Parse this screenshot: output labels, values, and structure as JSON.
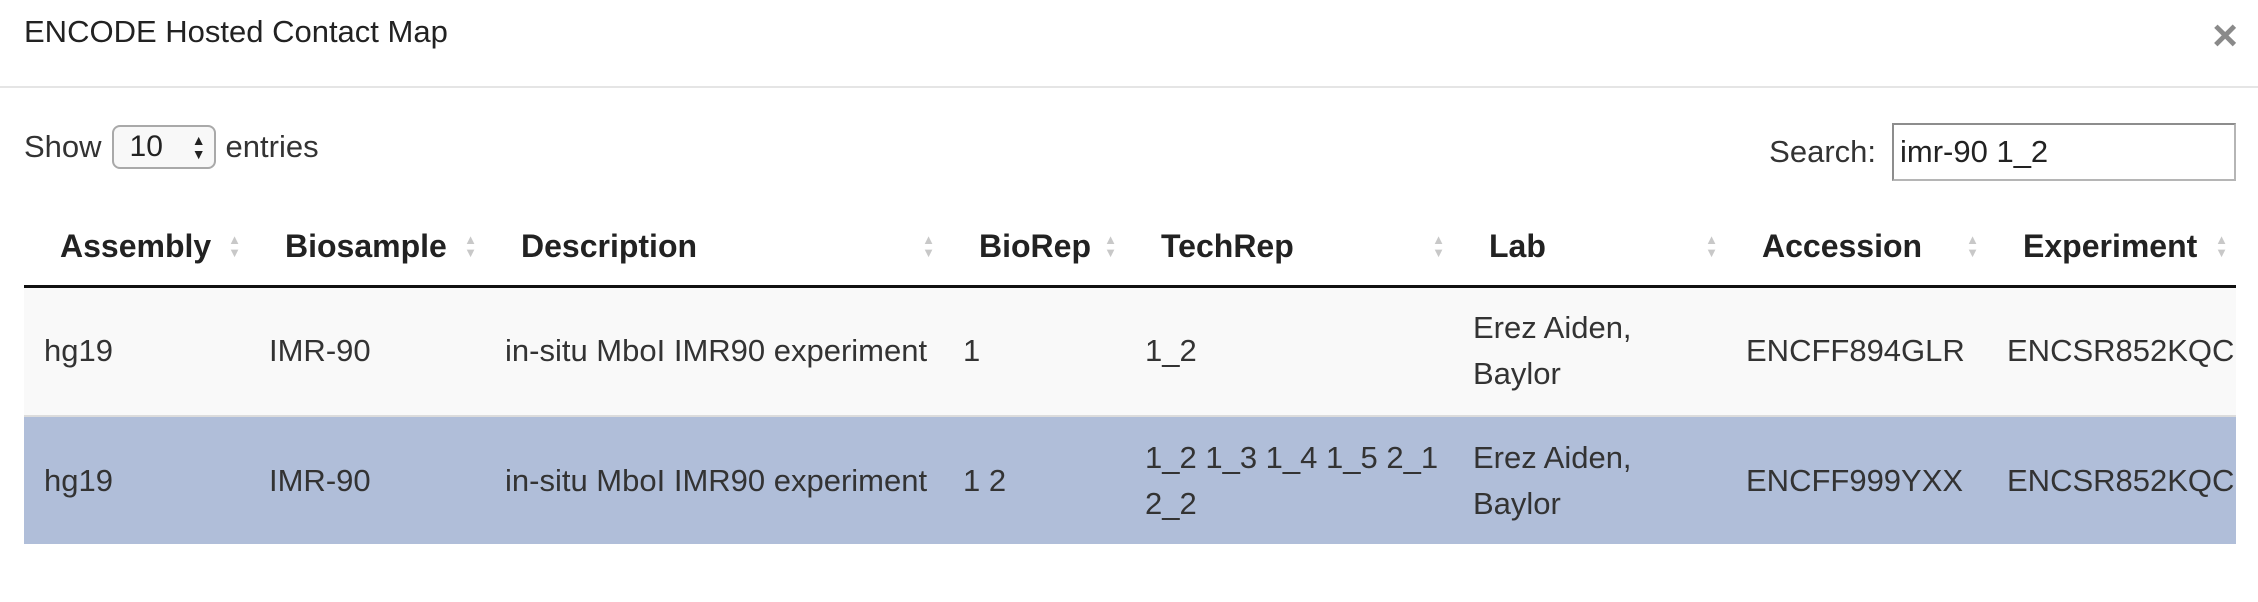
{
  "modal": {
    "title": "ENCODE Hosted Contact Map",
    "close_glyph": "×"
  },
  "length": {
    "prefix": "Show",
    "value": "10",
    "suffix": "entries"
  },
  "search": {
    "label": "Search:",
    "value": "imr-90 1_2"
  },
  "table": {
    "columns": [
      "Assembly",
      "Biosample",
      "Description",
      "BioRep",
      "TechRep",
      "Lab",
      "Accession",
      "Experiment"
    ],
    "rows": [
      {
        "assembly": "hg19",
        "biosample": "IMR-90",
        "description": "in-situ MboI IMR90 experiment",
        "biorep": "1",
        "techrep": "1_2",
        "lab": "Erez Aiden, Baylor",
        "accession": "ENCFF894GLR",
        "experiment": "ENCSR852KQC",
        "selected": false
      },
      {
        "assembly": "hg19",
        "biosample": "IMR-90",
        "description": "in-situ MboI IMR90 experiment",
        "biorep": "1 2",
        "techrep": "1_2 1_3 1_4 1_5 2_1 2_2",
        "lab": "Erez Aiden, Baylor",
        "accession": "ENCFF999YXX",
        "experiment": "ENCSR852KQC",
        "selected": true
      }
    ]
  },
  "colors": {
    "selected_row": "#b0bed9",
    "odd_row": "#f9f9f9",
    "header_rule": "#111111"
  }
}
